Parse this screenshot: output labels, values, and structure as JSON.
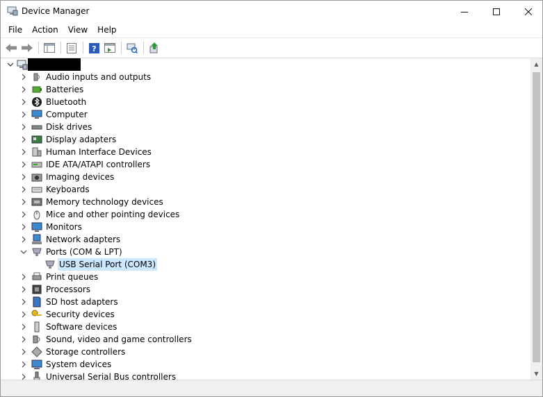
{
  "window": {
    "title": "Device Manager"
  },
  "menu": [
    "File",
    "Action",
    "View",
    "Help"
  ],
  "tree": {
    "root_label": "",
    "items": [
      {
        "label": "Audio inputs and outputs",
        "icon": "speaker-icon"
      },
      {
        "label": "Batteries",
        "icon": "battery-icon"
      },
      {
        "label": "Bluetooth",
        "icon": "bluetooth-icon"
      },
      {
        "label": "Computer",
        "icon": "computer-icon"
      },
      {
        "label": "Disk drives",
        "icon": "disk-drive-icon"
      },
      {
        "label": "Display adapters",
        "icon": "display-adapter-icon"
      },
      {
        "label": "Human Interface Devices",
        "icon": "hid-icon"
      },
      {
        "label": "IDE ATA/ATAPI controllers",
        "icon": "ide-controller-icon"
      },
      {
        "label": "Imaging devices",
        "icon": "camera-icon"
      },
      {
        "label": "Keyboards",
        "icon": "keyboard-icon"
      },
      {
        "label": "Memory technology devices",
        "icon": "memory-icon"
      },
      {
        "label": "Mice and other pointing devices",
        "icon": "mouse-icon"
      },
      {
        "label": "Monitors",
        "icon": "monitor-icon"
      },
      {
        "label": "Network adapters",
        "icon": "network-adapter-icon"
      },
      {
        "label": "Ports (COM & LPT)",
        "icon": "port-icon",
        "expanded": true,
        "children": [
          {
            "label": "USB Serial Port (COM3)",
            "icon": "port-icon",
            "selected": true
          }
        ]
      },
      {
        "label": "Print queues",
        "icon": "printer-icon"
      },
      {
        "label": "Processors",
        "icon": "processor-icon"
      },
      {
        "label": "SD host adapters",
        "icon": "sd-card-icon"
      },
      {
        "label": "Security devices",
        "icon": "security-key-icon"
      },
      {
        "label": "Software devices",
        "icon": "software-device-icon"
      },
      {
        "label": "Sound, video and game controllers",
        "icon": "sound-icon"
      },
      {
        "label": "Storage controllers",
        "icon": "storage-controller-icon"
      },
      {
        "label": "System devices",
        "icon": "system-device-icon"
      },
      {
        "label": "Universal Serial Bus controllers",
        "icon": "usb-icon"
      }
    ]
  }
}
